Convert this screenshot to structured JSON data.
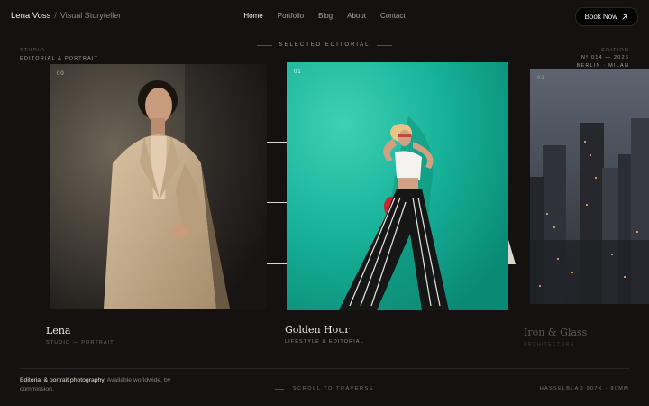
{
  "header": {
    "brand_name": "Lena Voss",
    "brand_sep": "/",
    "brand_tagline": "Visual Storyteller",
    "nav": [
      "Home",
      "Portfolio",
      "Blog",
      "About",
      "Contact"
    ],
    "book_label": "Book Now"
  },
  "meta": {
    "studio_label": "STUDIO",
    "studio_value": "EDITORIAL & PORTRAIT",
    "selected_label": "SELECTED EDITORIAL",
    "edition_label": "EDITION",
    "edition_number": "Nº 014 — 2026",
    "edition_cities": "BERLIN · MILAN"
  },
  "cards": [
    {
      "index": "00",
      "title": "Lena",
      "subtitle": "STUDIO — PORTRAIT"
    },
    {
      "index": "01",
      "title": "Golden Hour",
      "subtitle": "LIFESTYLE & EDITORIAL"
    },
    {
      "index": "02",
      "title": "Iron & Glass",
      "subtitle": "ARCHITECTURE"
    }
  ],
  "footer": {
    "lead_bold": "Editorial & portrait photography.",
    "lead_rest": "Available worldwide, by commission.",
    "scroll_hint": "SCROLL TO TRAVERSE",
    "gear": "HASSELBLAD 907X · 80MM"
  },
  "colors": {
    "background": "#141110",
    "accent_teal": "#17b39a",
    "text_primary": "#ece7e0",
    "text_muted": "#6f6861"
  }
}
